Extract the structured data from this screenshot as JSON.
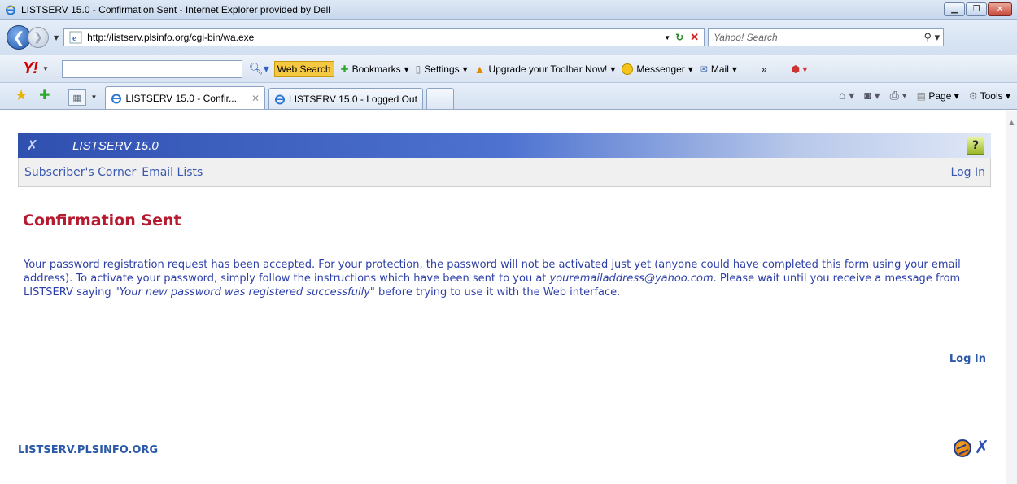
{
  "window": {
    "title": "LISTSERV 15.0 - Confirmation Sent - Internet Explorer provided by Dell"
  },
  "address_bar": {
    "url": "http://listserv.plsinfo.org/cgi-bin/wa.exe",
    "search_placeholder": "Yahoo! Search"
  },
  "yahoo_toolbar": {
    "logo": "Y!",
    "web_search": "Web Search",
    "bookmarks": "Bookmarks",
    "settings": "Settings",
    "upgrade": "Upgrade your Toolbar Now!",
    "messenger": "Messenger",
    "mail": "Mail",
    "more": "»"
  },
  "tabs": [
    {
      "label": "LISTSERV 15.0 - Confir...",
      "active": true
    },
    {
      "label": "LISTSERV 15.0 - Logged Out",
      "active": false
    }
  ],
  "command_bar": {
    "page": "Page",
    "tools": "Tools"
  },
  "site": {
    "banner_title": "LISTSERV 15.0",
    "help": "?",
    "nav": {
      "subscribers_corner": "Subscriber's Corner",
      "email_lists": "Email Lists",
      "log_in": "Log In"
    },
    "heading": "Confirmation Sent",
    "message": {
      "part1": "Your password registration request has been accepted. For your protection, the password will not be activated just yet (anyone could have completed this form using your email address). To activate your password, simply follow the instructions which have been sent to you at ",
      "email": "youremailaddress@yahoo.com",
      "part2": ". Please wait until you receive a message from LISTSERV saying ",
      "quote": "\"Your new password was registered successfully\"",
      "part3": " before trying to use it with the Web interface."
    },
    "log_in_link": "Log In",
    "footer_host": "LISTSERV.PLSINFO.ORG"
  }
}
